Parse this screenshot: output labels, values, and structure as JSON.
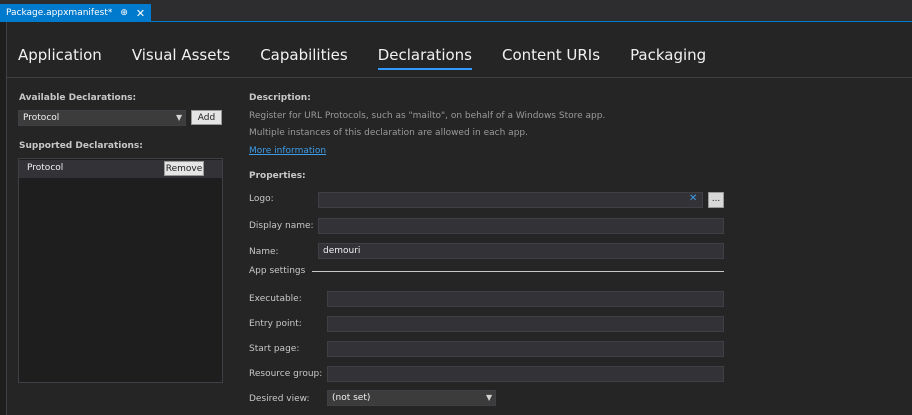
{
  "doc_tab": {
    "title": "Package.appxmanifest*",
    "pin": "⊕",
    "close": "✕"
  },
  "nav_tabs": [
    "Application",
    "Visual Assets",
    "Capabilities",
    "Declarations",
    "Content URIs",
    "Packaging"
  ],
  "left": {
    "available_title": "Available Declarations:",
    "available_value": "Protocol",
    "add_label": "Add",
    "supported_title": "Supported Declarations:",
    "supported_item": "Protocol",
    "remove_label": "Remove"
  },
  "right": {
    "description_title": "Description:",
    "desc_line1": "Register for URL Protocols, such as \"mailto\", on behalf of a Windows Store app.",
    "desc_line2": "Multiple instances of this declaration are allowed in each app.",
    "more_info": "More information",
    "properties_title": "Properties:",
    "logo_label": "Logo:",
    "logo_clear": "✕",
    "browse_label": "...",
    "display_name_label": "Display name:",
    "name_label": "Name:",
    "name_value": "demouri",
    "app_settings_label": "App settings",
    "executable_label": "Executable:",
    "entry_point_label": "Entry point:",
    "start_page_label": "Start page:",
    "resource_group_label": "Resource group:",
    "desired_view_label": "Desired view:",
    "desired_view_value": "(not set)"
  },
  "colors": {
    "accent": "#007acc",
    "link": "#3c9ce8",
    "background": "#252526"
  }
}
